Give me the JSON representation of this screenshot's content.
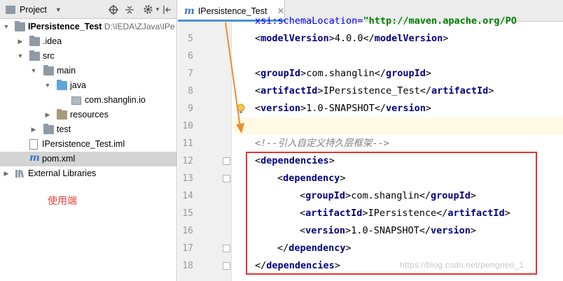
{
  "project_panel": {
    "title": "Project",
    "toolbar_icons": [
      "add-target-icon",
      "collapse-all-icon",
      "settings-icon",
      "hide-icon"
    ],
    "tree": [
      {
        "label": "IPersistence_Test",
        "path": "D:\\IEDA\\ZJava\\IPe",
        "icon": "module-folder-icon",
        "expanded": true
      },
      {
        "label": ".idea",
        "icon": "folder-icon",
        "expanded": false
      },
      {
        "label": "src",
        "icon": "folder-icon",
        "expanded": true
      },
      {
        "label": "main",
        "icon": "folder-icon",
        "expanded": true
      },
      {
        "label": "java",
        "icon": "source-folder-icon",
        "expanded": true
      },
      {
        "label": "com.shanglin.io",
        "icon": "package-icon"
      },
      {
        "label": "resources",
        "icon": "resources-folder-icon",
        "expanded": false
      },
      {
        "label": "test",
        "icon": "folder-icon",
        "expanded": false
      },
      {
        "label": "IPersistence_Test.iml",
        "icon": "iml-file-icon"
      },
      {
        "label": "pom.xml",
        "icon": "maven-file-icon",
        "selected": true
      },
      {
        "label": "External Libraries",
        "icon": "libraries-icon",
        "expanded": false
      }
    ],
    "annotation": "使用端"
  },
  "editor": {
    "tab": {
      "label": "IPersistence_Test",
      "icon": "maven-file-icon"
    },
    "lines": [
      {
        "num": "",
        "text": "xsi:schemaLocation=\"http://maven.apache.org/PO"
      },
      {
        "num": "5",
        "text": "<modelVersion>4.0.0</modelVersion>"
      },
      {
        "num": "6",
        "text": ""
      },
      {
        "num": "7",
        "text": "<groupId>com.shanglin</groupId>"
      },
      {
        "num": "8",
        "text": "<artifactId>IPersistence_Test</artifactId>"
      },
      {
        "num": "9",
        "text": "<version>1.0-SNAPSHOT</version>"
      },
      {
        "num": "10",
        "text": ""
      },
      {
        "num": "11",
        "text": "<!--引入自定义持久层框架-->"
      },
      {
        "num": "12",
        "text": "<dependencies>"
      },
      {
        "num": "13",
        "text": "<dependency>"
      },
      {
        "num": "14",
        "text": "<groupId>com.shanglin</groupId>"
      },
      {
        "num": "15",
        "text": "<artifactId>IPersistence</artifactId>"
      },
      {
        "num": "16",
        "text": "<version>1.0-SNAPSHOT</version>"
      },
      {
        "num": "17",
        "text": "</dependency>"
      },
      {
        "num": "18",
        "text": "</dependencies>"
      }
    ],
    "code": {
      "l4_attr": "xsi:schemaLocation=",
      "l4_val": "\"http://maven.apache.org/PO",
      "model_version": "4.0.0",
      "group_id": "com.shanglin",
      "artifact_id": "IPersistence_Test",
      "version": "1.0-SNAPSHOT",
      "comment": "<!--引入自定义持久层框架-->",
      "dep_group_id": "com.shanglin",
      "dep_artifact_id": "IPersistence",
      "dep_version": "1.0-SNAPSHOT"
    },
    "tags": {
      "modelVersion": "modelVersion",
      "groupId": "groupId",
      "artifactId": "artifactId",
      "version": "version",
      "dependencies": "dependencies",
      "dependency": "dependency"
    }
  },
  "watermark": "https://blog.csdn.net/pengrieo_1",
  "colors": {
    "highlight_border": "#e53333",
    "annotation_text": "#e84040",
    "arrow": "#f08c30"
  }
}
